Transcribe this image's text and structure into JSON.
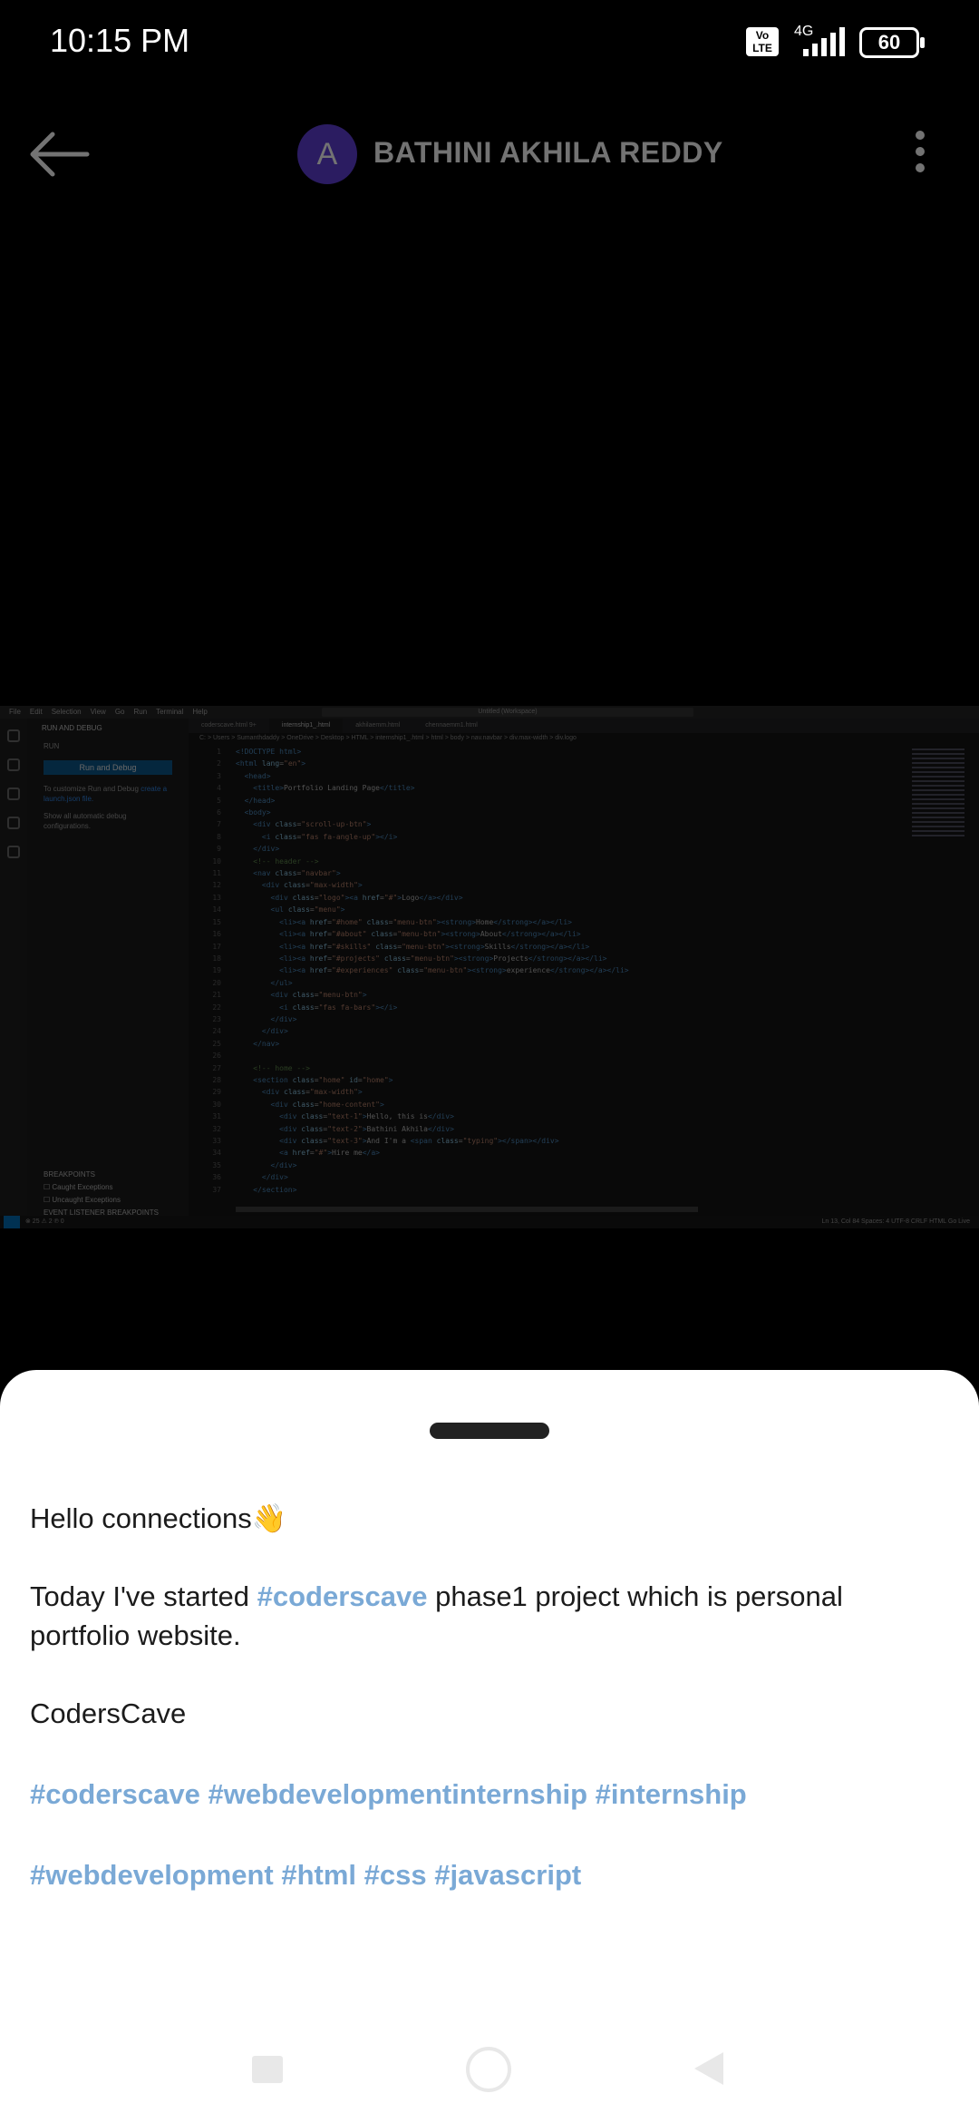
{
  "status_bar": {
    "time": "10:15 PM",
    "volte": "Vo LTE",
    "network": "4G",
    "battery": "60"
  },
  "app_bar": {
    "avatar_letter": "A",
    "title": "BATHINI AKHILA REDDY",
    "back_icon": "arrow-left-icon",
    "more_icon": "more-vertical-icon"
  },
  "code_screenshot": {
    "menu": [
      "File",
      "Edit",
      "Selection",
      "View",
      "Go",
      "Run",
      "Terminal",
      "Help"
    ],
    "search": "Untitled (Workspace)",
    "sidebar_title": "RUN AND DEBUG",
    "sidebar_section": "RUN",
    "run_button": "Run and Debug",
    "sidebar_text1": "To customize Run and Debug",
    "sidebar_link1": "create a launch.json file.",
    "sidebar_link2": "Show all automatic debug configurations.",
    "breakpoints": "BREAKPOINTS",
    "bp1": "Caught Exceptions",
    "bp2": "Uncaught Exceptions",
    "bp3": "EVENT LISTENER BREAKPOINTS",
    "tabs": [
      "coderscave.html 9+",
      "internship1_.html",
      "akhilaemm.html",
      "chennaemm1.html"
    ],
    "breadcrumb": "C: > Users > Sumanthdaddy > OneDrive > Desktop > HTML > internship1_.html > html > body > nav.navbar > div.max-width > div.logo",
    "status_left": "⊗ 25 ⚠ 2  ℗ 0",
    "status_right": "Ln 13, Col 84  Spaces: 4  UTF-8  CRLF  HTML  Go Live"
  },
  "post": {
    "line1": "Hello  connections👋",
    "line2_prefix": "Today I've started ",
    "line2_hashtag": "#coderscave",
    "line2_suffix": " phase1 project which is personal portfolio website.",
    "line3": "CodersCave",
    "hashtags_row1": "#coderscave #webdevelopmentinternship #internship",
    "hashtags_row2": "#webdevelopment #html #css #javascript"
  },
  "colors": {
    "hashtag": "#7aa9d6",
    "avatar": "#5f3fd7",
    "sheet_bg": "#ffffff"
  }
}
